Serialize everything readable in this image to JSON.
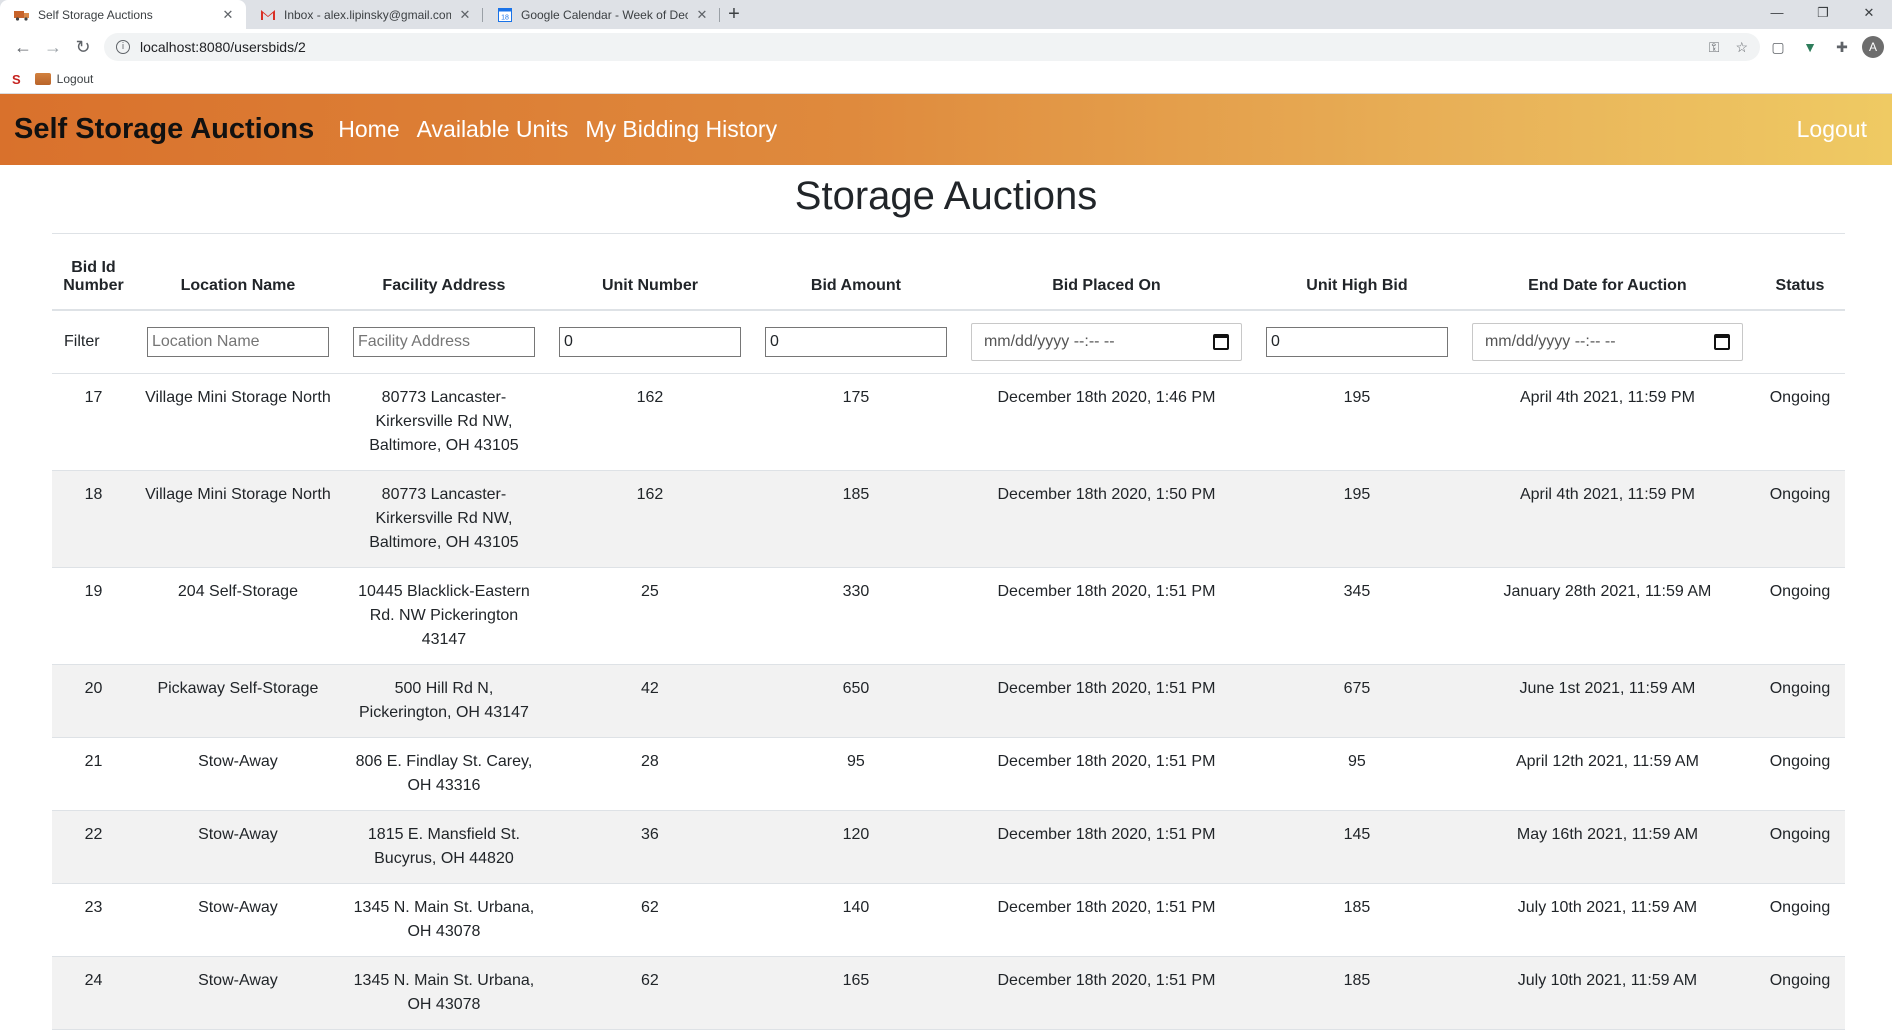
{
  "browser": {
    "tabs": [
      {
        "title": "Self Storage Auctions",
        "favicon": "truck-icon",
        "active": true
      },
      {
        "title": "Inbox - alex.lipinsky@gmail.com",
        "favicon": "gmail-icon",
        "active": false
      },
      {
        "title": "Google Calendar - Week of Dece",
        "favicon": "calendar-icon",
        "active": false
      }
    ],
    "url": "localhost:8080/usersbids/2",
    "bookmarks": [
      {
        "label": "Logout"
      }
    ],
    "profile_initial": "A"
  },
  "nav": {
    "brand": "Self Storage Auctions",
    "links": [
      "Home",
      "Available Units",
      "My Bidding History"
    ],
    "logout": "Logout"
  },
  "page": {
    "title": "Storage Auctions"
  },
  "table": {
    "headers": [
      "Bid Id Number",
      "Location Name",
      "Facility Address",
      "Unit Number",
      "Bid Amount",
      "Bid Placed On",
      "Unit High Bid",
      "End Date for Auction",
      "Status"
    ],
    "filter": {
      "label": "Filter",
      "location_placeholder": "Location Name",
      "address_placeholder": "Facility Address",
      "unit_value": "0",
      "bid_value": "0",
      "placed_value": "mm/dd/yyyy --:-- --",
      "high_value": "0",
      "end_value": "mm/dd/yyyy --:-- --"
    },
    "rows": [
      {
        "id": "17",
        "location": "Village Mini Storage North",
        "address": "80773 Lancaster-Kirkersville Rd NW, Baltimore, OH 43105",
        "unit": "162",
        "bid": "175",
        "placed": "December 18th 2020, 1:46 PM",
        "high": "195",
        "end": "April 4th 2021, 11:59 PM",
        "status": "Ongoing"
      },
      {
        "id": "18",
        "location": "Village Mini Storage North",
        "address": "80773 Lancaster-Kirkersville Rd NW, Baltimore, OH 43105",
        "unit": "162",
        "bid": "185",
        "placed": "December 18th 2020, 1:50 PM",
        "high": "195",
        "end": "April 4th 2021, 11:59 PM",
        "status": "Ongoing"
      },
      {
        "id": "19",
        "location": "204 Self-Storage",
        "address": "10445 Blacklick-Eastern Rd. NW Pickerington 43147",
        "unit": "25",
        "bid": "330",
        "placed": "December 18th 2020, 1:51 PM",
        "high": "345",
        "end": "January 28th 2021, 11:59 AM",
        "status": "Ongoing"
      },
      {
        "id": "20",
        "location": "Pickaway Self-Storage",
        "address": "500 Hill Rd N, Pickerington, OH 43147",
        "unit": "42",
        "bid": "650",
        "placed": "December 18th 2020, 1:51 PM",
        "high": "675",
        "end": "June 1st 2021, 11:59 AM",
        "status": "Ongoing"
      },
      {
        "id": "21",
        "location": "Stow-Away",
        "address": "806 E. Findlay St. Carey, OH 43316",
        "unit": "28",
        "bid": "95",
        "placed": "December 18th 2020, 1:51 PM",
        "high": "95",
        "end": "April 12th 2021, 11:59 AM",
        "status": "Ongoing"
      },
      {
        "id": "22",
        "location": "Stow-Away",
        "address": "1815 E. Mansfield St. Bucyrus, OH 44820",
        "unit": "36",
        "bid": "120",
        "placed": "December 18th 2020, 1:51 PM",
        "high": "145",
        "end": "May 16th 2021, 11:59 AM",
        "status": "Ongoing"
      },
      {
        "id": "23",
        "location": "Stow-Away",
        "address": "1345 N. Main St. Urbana, OH 43078",
        "unit": "62",
        "bid": "140",
        "placed": "December 18th 2020, 1:51 PM",
        "high": "185",
        "end": "July 10th 2021, 11:59 AM",
        "status": "Ongoing"
      },
      {
        "id": "24",
        "location": "Stow-Away",
        "address": "1345 N. Main St. Urbana, OH 43078",
        "unit": "62",
        "bid": "165",
        "placed": "December 18th 2020, 1:51 PM",
        "high": "185",
        "end": "July 10th 2021, 11:59 AM",
        "status": "Ongoing"
      }
    ]
  }
}
